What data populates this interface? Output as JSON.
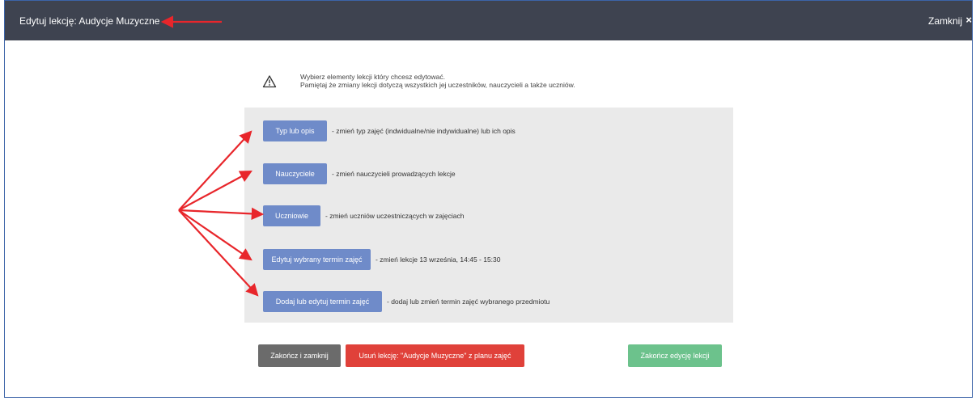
{
  "window": {
    "title": "Edytuj lekcję: Audycje Muzyczne",
    "close_label": "Zamknij",
    "close_icon": "×"
  },
  "info": {
    "line1": "Wybierz elementy lekcji który chcesz edytować.",
    "line2": "Pamiętaj że zmiany lekcji dotyczą wszystkich jej uczestników, nauczycieli a także uczniów."
  },
  "options": [
    {
      "label": "Typ lub opis",
      "description": "- zmień typ zajęć (indwidualne/nie indywidualne) lub ich opis"
    },
    {
      "label": "Nauczyciele",
      "description": "- zmień nauczycieli prowadzących lekcje"
    },
    {
      "label": "Uczniowie",
      "description": "- zmień uczniów uczestniczących w zajęciach"
    },
    {
      "label": "Edytuj wybrany termin zajęć",
      "description": "- zmień lekcje 13 września, 14:45 - 15:30"
    },
    {
      "label": "Dodaj lub edytuj termin zajęć",
      "description": "- dodaj lub zmień termin zajęć wybranego przedmiotu"
    }
  ],
  "footer": {
    "finish_close": "Zakończ i zamknij",
    "delete_lesson": "Usuń lekcję: \"Audycje Muzyczne\" z planu zajęć",
    "finish_edit": "Zakończ edycję lekcji"
  },
  "colors": {
    "titlebar": "#3e4350",
    "option_button": "#6f8bc9",
    "finish_close_button": "#6b6b6b",
    "delete_button": "#e0413a",
    "finish_edit_button": "#6cc28c",
    "annotation_arrow": "#e8262b"
  },
  "icons": {
    "warning": "warning-triangle-icon"
  }
}
